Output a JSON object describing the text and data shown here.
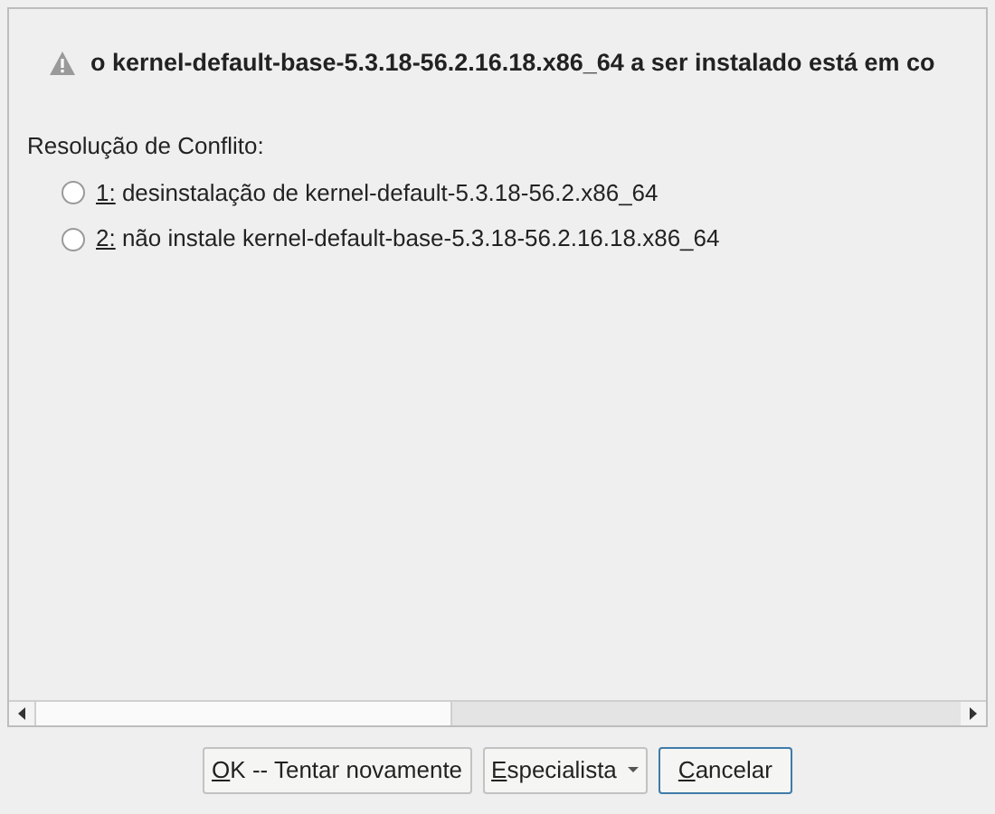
{
  "message": "o kernel-default-base-5.3.18-56.2.16.18.x86_64 a ser instalado está em co",
  "resolution": {
    "label": "Resolução de Conflito:",
    "options": [
      {
        "label": "1: desinstalação de kernel-default-5.3.18-56.2.x86_64",
        "selected": false
      },
      {
        "label": "2: não instale kernel-default-base-5.3.18-56.2.16.18.x86_64",
        "selected": false
      }
    ]
  },
  "buttons": [
    {
      "label": "OK -- Tentar novamente",
      "kind": "plain",
      "focused": false
    },
    {
      "label": "Especialista",
      "kind": "menu",
      "focused": false
    },
    {
      "label": "Cancelar",
      "kind": "plain",
      "focused": true
    }
  ]
}
